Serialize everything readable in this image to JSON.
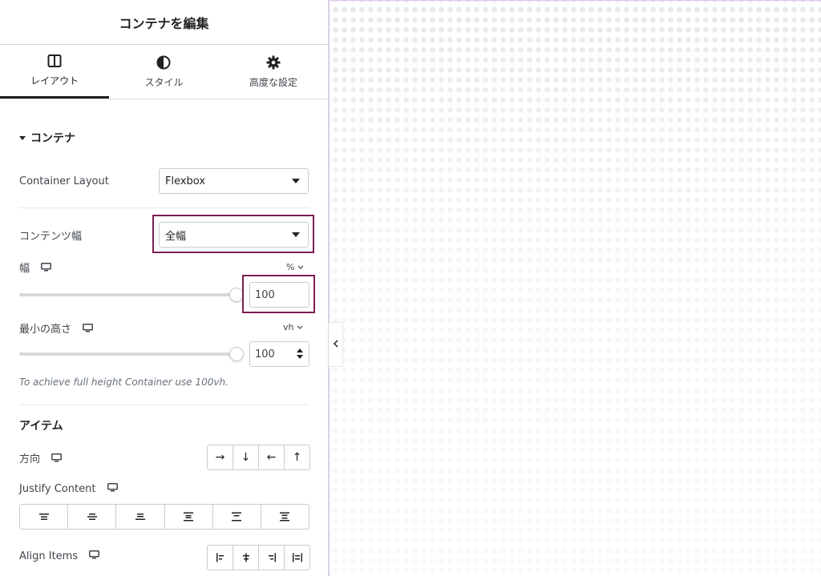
{
  "header": {
    "title": "コンテナを編集"
  },
  "tabs": [
    {
      "label": "レイアウト",
      "icon": "layout-columns-icon",
      "active": true
    },
    {
      "label": "スタイル",
      "icon": "contrast-icon",
      "active": false
    },
    {
      "label": "高度な設定",
      "icon": "gear-icon",
      "active": false
    }
  ],
  "section": {
    "title": "コンテナ"
  },
  "container_layout": {
    "label": "Container Layout",
    "value": "Flexbox"
  },
  "content_width": {
    "label": "コンテンツ幅",
    "value": "全幅"
  },
  "width": {
    "label": "幅",
    "unit": "%",
    "value": "100",
    "slider_fraction": 1.0
  },
  "min_height": {
    "label": "最小の高さ",
    "unit": "vh",
    "value": "100",
    "slider_fraction": 1.0
  },
  "note": "To achieve full height Container use 100vh.",
  "items_section": {
    "title": "アイテム"
  },
  "direction": {
    "label": "方向",
    "buttons": [
      "→",
      "↓",
      "←",
      "↑"
    ]
  },
  "justify_content": {
    "label": "Justify Content",
    "buttons": [
      "justify-start-icon",
      "justify-center-icon",
      "justify-end-icon",
      "justify-space-between-icon",
      "justify-space-around-icon",
      "justify-space-evenly-icon"
    ]
  },
  "align_items": {
    "label": "Align Items",
    "buttons": [
      "align-start-icon",
      "align-center-icon",
      "align-end-icon",
      "align-stretch-icon"
    ]
  },
  "colors": {
    "highlight": "#7a1f4f",
    "canvas_border": "#e0c4e8"
  }
}
